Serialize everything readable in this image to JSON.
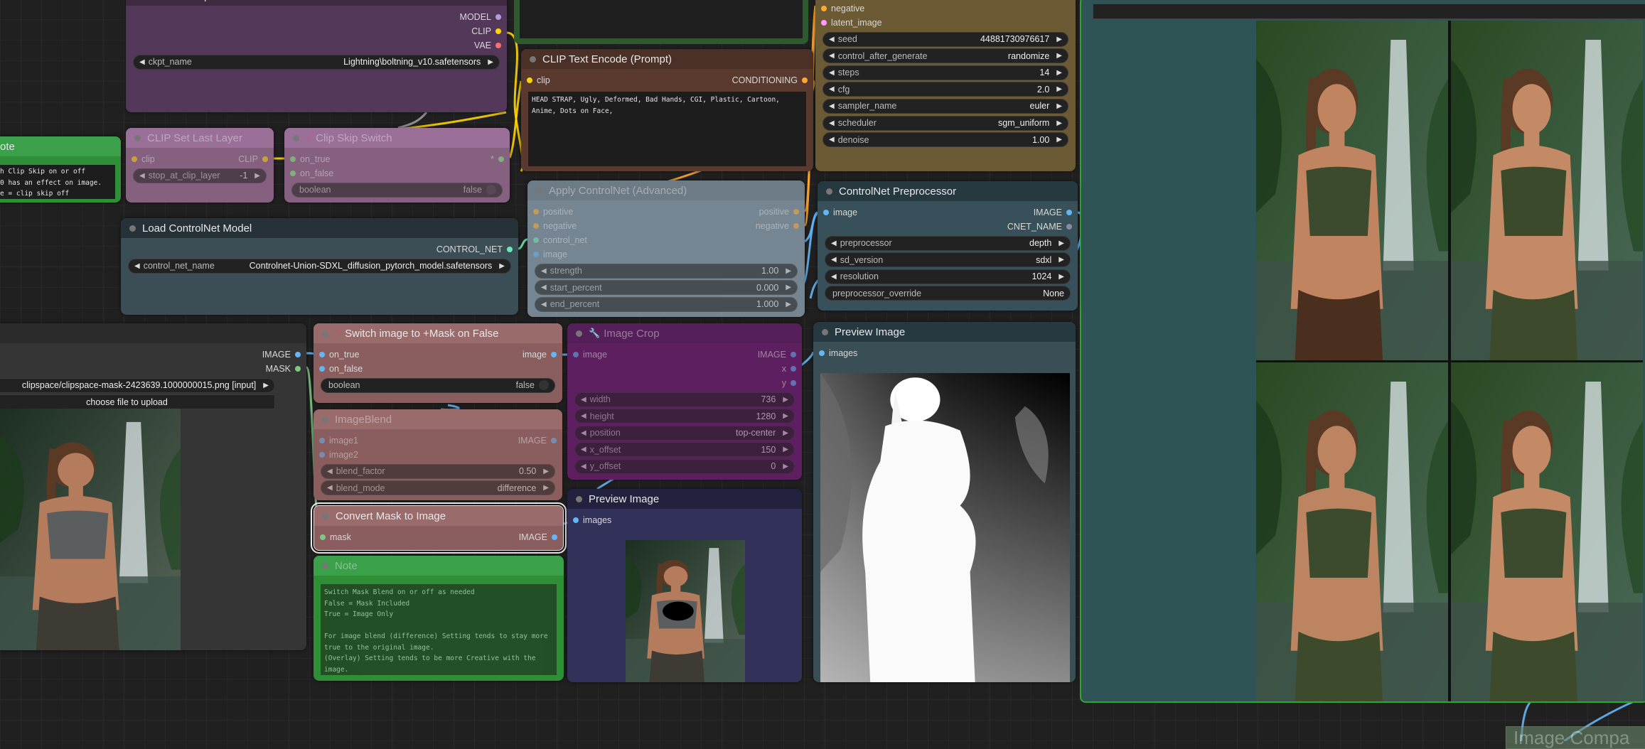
{
  "slot_colors": {
    "MODEL": "#b39ddb",
    "CLIP": "#ffd500",
    "VAE": "#ff6e6e",
    "CONDITIONING": "#ffa931",
    "LATENT": "#ff9cf9",
    "IMAGE": "#64b5f6",
    "MASK": "#81c784",
    "CONTROL_NET": "#6ee7b7",
    "ANY": "#7cf07c",
    "CNET": "#8a8aa8",
    "INT": "#64b5f6"
  },
  "nodes": {
    "checkpoint": {
      "title": "Load Checkpoint",
      "inputs": [],
      "outputs": [
        {
          "name": "MODEL",
          "type": "MODEL"
        },
        {
          "name": "CLIP",
          "type": "CLIP"
        },
        {
          "name": "VAE",
          "type": "VAE"
        }
      ],
      "widgets": [
        {
          "label": "ckpt_name",
          "value": "Lightning\\boltning_v10.safetensors"
        }
      ]
    },
    "clipText": {
      "title": "CLIP Text Encode (Prompt)",
      "inputs": [
        {
          "name": "clip",
          "type": "CLIP"
        }
      ],
      "outputs": [
        {
          "name": "CONDITIONING",
          "type": "CONDITIONING"
        }
      ],
      "text": "HEAD STRAP, Ugly, Deformed, Bad Hands, CGI, Plastic, Cartoon, Anime, Dots on Face,"
    },
    "ksampler": {
      "title": "KSampler",
      "inputs": [
        {
          "name": "negative",
          "type": "CONDITIONING"
        },
        {
          "name": "latent_image",
          "type": "LATENT"
        }
      ],
      "outputs": [],
      "widgets": [
        {
          "label": "seed",
          "value": "44881730976617"
        },
        {
          "label": "control_after_generate",
          "value": "randomize"
        },
        {
          "label": "steps",
          "value": "14"
        },
        {
          "label": "cfg",
          "value": "2.0"
        },
        {
          "label": "sampler_name",
          "value": "euler"
        },
        {
          "label": "scheduler",
          "value": "sgm_uniform"
        },
        {
          "label": "denoise",
          "value": "1.00"
        }
      ]
    },
    "noteLeft": {
      "title": "ote",
      "text": "h Clip Skip on or off\n0 has an effect on image.\ne = clip skip off"
    },
    "clipSetLast": {
      "title": "CLIP Set Last Layer",
      "dim": true,
      "inputs": [
        {
          "name": "clip",
          "type": "CLIP"
        }
      ],
      "outputs": [
        {
          "name": "CLIP",
          "type": "CLIP"
        }
      ],
      "widgets": [
        {
          "label": "stop_at_clip_layer",
          "value": "-1"
        }
      ]
    },
    "clipSkipSwitch": {
      "title": "Clip Skip Switch",
      "dim": true,
      "icon": "wand",
      "inputs": [
        {
          "name": "on_true",
          "type": "ANY"
        },
        {
          "name": "on_false",
          "type": "ANY"
        }
      ],
      "outputs": [
        {
          "name": "*",
          "type": "ANY"
        }
      ],
      "widgets": [
        {
          "label": "boolean",
          "value": "false",
          "kind": "toggle"
        }
      ]
    },
    "loadControlNet": {
      "title": "Load ControlNet Model",
      "inputs": [],
      "outputs": [
        {
          "name": "CONTROL_NET",
          "type": "CONTROL_NET"
        }
      ],
      "widgets": [
        {
          "label": "control_net_name",
          "value": "Controlnet-Union-SDXL_diffusion_pytorch_model.safetensors"
        }
      ]
    },
    "applyCN": {
      "title": "Apply ControlNet (Advanced)",
      "dim": true,
      "inputs": [
        {
          "name": "positive",
          "type": "CONDITIONING"
        },
        {
          "name": "negative",
          "type": "CONDITIONING"
        },
        {
          "name": "control_net",
          "type": "CONTROL_NET"
        },
        {
          "name": "image",
          "type": "IMAGE"
        }
      ],
      "outputs": [
        {
          "name": "positive",
          "type": "CONDITIONING"
        },
        {
          "name": "negative",
          "type": "CONDITIONING"
        }
      ],
      "widgets": [
        {
          "label": "strength",
          "value": "1.00"
        },
        {
          "label": "start_percent",
          "value": "0.000"
        },
        {
          "label": "end_percent",
          "value": "1.000"
        }
      ]
    },
    "cnPre": {
      "title": "ControlNet Preprocessor",
      "inputs": [
        {
          "name": "image",
          "type": "IMAGE"
        }
      ],
      "outputs": [
        {
          "name": "IMAGE",
          "type": "IMAGE"
        },
        {
          "name": "CNET_NAME",
          "type": "CNET"
        }
      ],
      "widgets": [
        {
          "label": "preprocessor",
          "value": "depth"
        },
        {
          "label": "sd_version",
          "value": "sdxl"
        },
        {
          "label": "resolution",
          "value": "1024"
        },
        {
          "label": "preprocessor_override",
          "value": "None",
          "kind": "plain"
        }
      ]
    },
    "loadImage": {
      "title": "",
      "inputs": [],
      "outputs": [
        {
          "name": "IMAGE",
          "type": "IMAGE"
        },
        {
          "name": "MASK",
          "type": "MASK"
        }
      ],
      "widgets": [
        {
          "label": "",
          "value": "clipspace/clipspace-mask-2423639.1000000015.png [input]"
        },
        {
          "label": "",
          "value": "choose file to upload",
          "kind": "button"
        }
      ]
    },
    "switchImage": {
      "title": "Switch image to +Mask on False",
      "icon": "wand",
      "inputs": [
        {
          "name": "on_true",
          "type": "IMAGE"
        },
        {
          "name": "on_false",
          "type": "IMAGE"
        }
      ],
      "outputs": [
        {
          "name": "image",
          "type": "IMAGE"
        }
      ],
      "widgets": [
        {
          "label": "boolean",
          "value": "false",
          "kind": "toggle"
        }
      ]
    },
    "imageBlend": {
      "title": "ImageBlend",
      "dim": true,
      "inputs": [
        {
          "name": "image1",
          "type": "IMAGE"
        },
        {
          "name": "image2",
          "type": "IMAGE"
        }
      ],
      "outputs": [
        {
          "name": "IMAGE",
          "type": "IMAGE"
        }
      ],
      "widgets": [
        {
          "label": "blend_factor",
          "value": "0.50"
        },
        {
          "label": "blend_mode",
          "value": "difference"
        }
      ]
    },
    "convertMask": {
      "title": "Convert Mask to Image",
      "inputs": [
        {
          "name": "mask",
          "type": "MASK"
        }
      ],
      "outputs": [
        {
          "name": "IMAGE",
          "type": "IMAGE"
        }
      ]
    },
    "noteBottom": {
      "title": "Note",
      "dim": true,
      "text": "Switch Mask Blend on or off as needed\nFalse = Mask Included\nTrue = Image Only\n\nFor image blend (difference) Setting tends to stay more true to the original image.\n(Overlay) Setting tends to be more Creative with the image."
    },
    "imageCrop": {
      "title": "Image Crop",
      "dim": true,
      "icon": "wrench",
      "inputs": [
        {
          "name": "image",
          "type": "IMAGE"
        }
      ],
      "outputs": [
        {
          "name": "IMAGE",
          "type": "IMAGE"
        },
        {
          "name": "x",
          "type": "INT"
        },
        {
          "name": "y",
          "type": "INT"
        }
      ],
      "widgets": [
        {
          "label": "width",
          "value": "736"
        },
        {
          "label": "height",
          "value": "1280"
        },
        {
          "label": "position",
          "value": "top-center"
        },
        {
          "label": "x_offset",
          "value": "150"
        },
        {
          "label": "y_offset",
          "value": "0"
        }
      ]
    },
    "previewSmall": {
      "title": "Preview Image",
      "inputs": [
        {
          "name": "images",
          "type": "IMAGE"
        }
      ],
      "outputs": []
    },
    "previewLarge": {
      "title": "Preview Image",
      "inputs": [
        {
          "name": "images",
          "type": "IMAGE"
        }
      ],
      "outputs": []
    }
  },
  "bottom_node_label": "Image Compa"
}
